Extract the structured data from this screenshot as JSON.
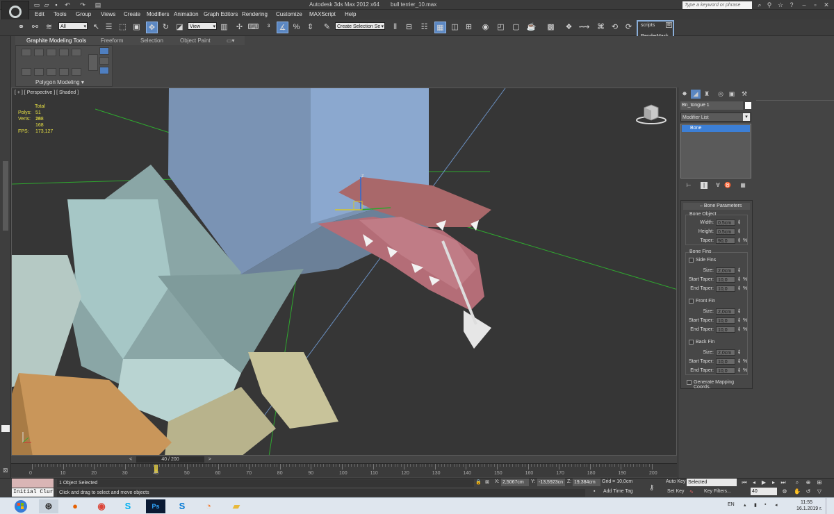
{
  "titlebar": {
    "app_title": "Autodesk 3ds Max  2012 x64",
    "file_name": "bull terrier_10.max",
    "search_placeholder": "Type a keyword or phrase"
  },
  "menu": [
    "Edit",
    "Tools",
    "Group",
    "Views",
    "Create",
    "Modifiers",
    "Animation",
    "Graph Editors",
    "Rendering",
    "Customize",
    "MAXScript",
    "Help"
  ],
  "toolbar": {
    "filter_value": "All",
    "ref_coord_value": "View",
    "selection_set_value": "Create Selection Se"
  },
  "scripts_panel": {
    "title": "scripts",
    "close": "⊠",
    "button": "RenderMask"
  },
  "ribbon": {
    "tabs": [
      "Graphite Modeling Tools",
      "Freeform",
      "Selection",
      "Object Paint"
    ],
    "panel_label": "Polygon Modeling"
  },
  "viewport": {
    "label": "[ + ] [ Perspective ] [ Shaded ]",
    "stats": {
      "total_label": "Total",
      "polys_label": "Polys:",
      "polys_value": "51 138",
      "verts_label": "Verts:",
      "verts_value": "26 168",
      "fps_label": "FPS:",
      "fps_value": "173,127"
    }
  },
  "command_panel": {
    "object_name": "Bn_tongue 1",
    "modifier_list": "Modifier List",
    "stack_item": "Bone",
    "rollout_title": "Bone Parameters",
    "bone_object": {
      "title": "Bone Object",
      "width_label": "Width:",
      "width_value": "0,5cm",
      "height_label": "Height:",
      "height_value": "0,5cm",
      "taper_label": "Taper:",
      "taper_value": "90,0",
      "pct": "%"
    },
    "bone_fins": {
      "title": "Bone Fins",
      "side_fins": "Side Fins",
      "front_fin": "Front Fin",
      "back_fin": "Back Fin",
      "size_label": "Size:",
      "start_taper_label": "Start Taper:",
      "end_taper_label": "End Taper:",
      "size_value": "2,0cm",
      "taper_value": "10,0",
      "pct": "%"
    },
    "gen_mapping": "Generate Mapping Coords."
  },
  "timeline": {
    "frame_display": "40 / 200",
    "prev": "<",
    "next": ">",
    "ticks": [
      "0",
      "10",
      "20",
      "30",
      "40",
      "50",
      "60",
      "70",
      "80",
      "90",
      "100",
      "110",
      "120",
      "130",
      "140",
      "150",
      "160",
      "170",
      "180",
      "190",
      "200"
    ],
    "current_frame": 40,
    "total_frames": 200
  },
  "status": {
    "listener": "Initial Clur",
    "selection": "1 Object Selected",
    "hint": "Click and drag to select and move objects",
    "x_label": "X:",
    "x_value": "2,5067cm",
    "y_label": "Y:",
    "y_value": "-13,5923cn",
    "z_label": "Z:",
    "z_value": "19,384cm",
    "grid": "Grid = 10,0cm",
    "add_time_tag": "Add Time Tag",
    "auto_key": "Auto Key",
    "set_key": "Set Key",
    "selected_dd": "Selected",
    "key_filters": "Key Filters...",
    "frame_value": "40"
  },
  "taskbar": {
    "apps": [
      "Start",
      "3ds Max",
      "Firefox",
      "Chrome",
      "Skype",
      "Photoshop",
      "Skype for Business",
      "Blender",
      "File Explorer"
    ],
    "lang": "EN",
    "time": "11:55",
    "date": "16.1.2019 г."
  },
  "colors": {
    "viewport_bg": "#363636",
    "selection_blue": "#3c7fd6",
    "stats_yellow": "#e7e044",
    "grid_green": "#2fa82f",
    "ui_gray": "#444444"
  }
}
